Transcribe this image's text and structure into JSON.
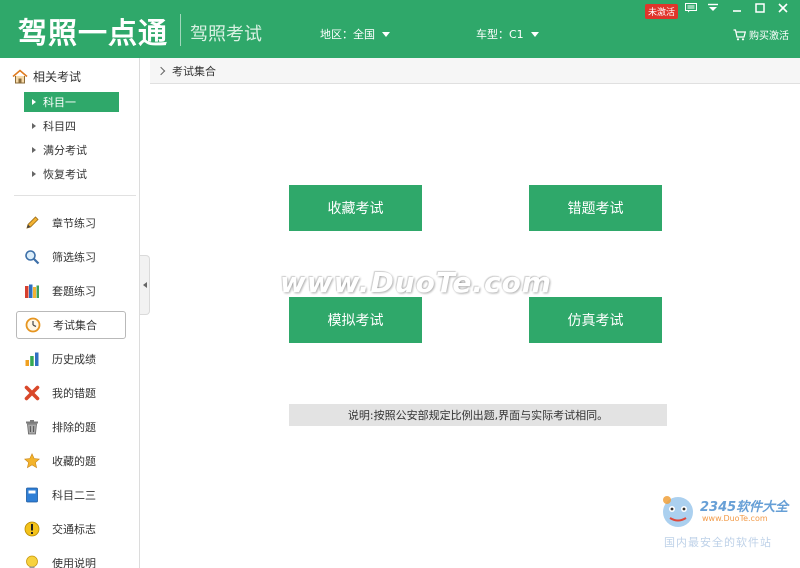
{
  "header": {
    "app_name": "驾照一点通",
    "subtitle": "驾照考试",
    "region_label": "地区：全国",
    "car_type_label": "车型：C1",
    "not_activated_badge": "未激活",
    "buy_activate": "购买激活",
    "brand_color": "#2fa86a"
  },
  "sidebar": {
    "section_title": "相关考试",
    "subjects": [
      "科目一",
      "科目四",
      "满分考试",
      "恢复考试"
    ],
    "active_subject": "科目一",
    "nav": [
      {
        "label": "章节练习",
        "icon": "pencil-icon"
      },
      {
        "label": "筛选练习",
        "icon": "magnifier-icon"
      },
      {
        "label": "套题练习",
        "icon": "books-icon"
      },
      {
        "label": "考试集合",
        "icon": "clock-icon"
      },
      {
        "label": "历史成绩",
        "icon": "bar-chart-icon"
      },
      {
        "label": "我的错题",
        "icon": "red-x-icon"
      },
      {
        "label": "排除的题",
        "icon": "trash-icon"
      },
      {
        "label": "收藏的题",
        "icon": "star-icon"
      },
      {
        "label": "科目二三",
        "icon": "notebook-icon"
      },
      {
        "label": "交通标志",
        "icon": "warning-icon"
      },
      {
        "label": "使用说明",
        "icon": "bulb-icon"
      }
    ],
    "active_nav": "考试集合"
  },
  "main": {
    "breadcrumb": "考试集合",
    "buttons": [
      "收藏考试",
      "错题考试",
      "模拟考试",
      "仿真考试"
    ],
    "note": "说明:按照公安部规定比例出题,界面与实际考试相同。"
  },
  "watermarks": {
    "center": "www.DuoTe.com",
    "corner_brand": "2345软件大全",
    "corner_url": "www.DuoTe.com",
    "corner_footer": "国内最安全的软件站"
  }
}
